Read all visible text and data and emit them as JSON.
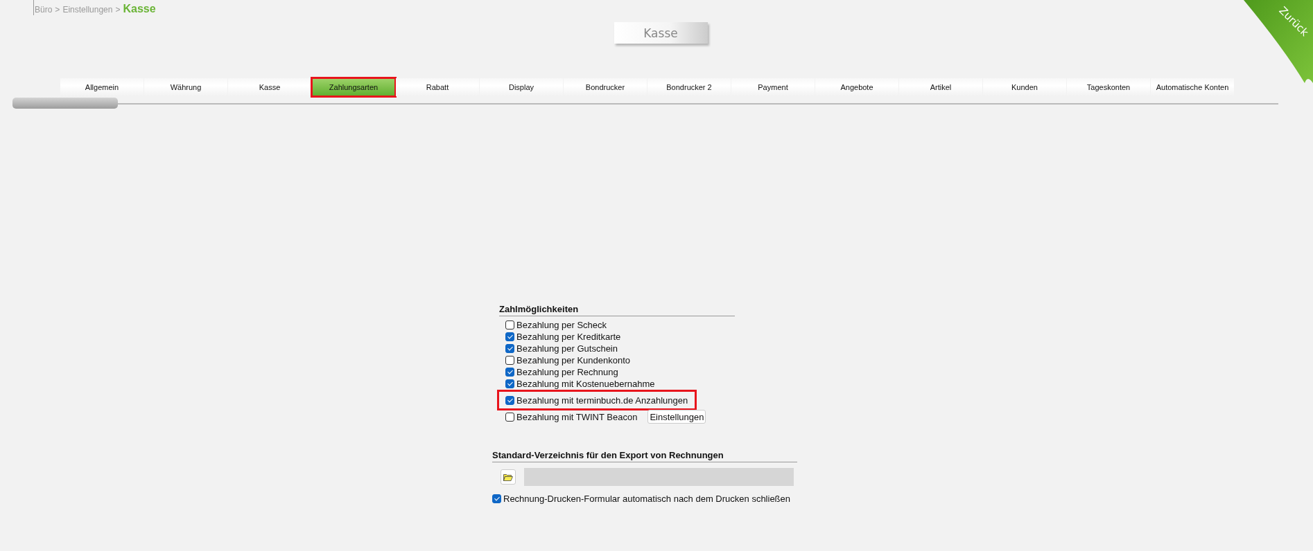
{
  "breadcrumb": {
    "items": [
      "Büro",
      "Einstellungen"
    ],
    "separator": ">",
    "current": "Kasse"
  },
  "page_title": "Kasse",
  "back_button": "Zurück",
  "tabs": [
    {
      "label": "Allgemein",
      "selected": false,
      "highlighted": false
    },
    {
      "label": "Währung",
      "selected": false,
      "highlighted": false
    },
    {
      "label": "Kasse",
      "selected": false,
      "highlighted": false
    },
    {
      "label": "Zahlungsarten",
      "selected": true,
      "highlighted": true
    },
    {
      "label": "Rabatt",
      "selected": false,
      "highlighted": false
    },
    {
      "label": "Display",
      "selected": false,
      "highlighted": false
    },
    {
      "label": "Bondrucker",
      "selected": false,
      "highlighted": false
    },
    {
      "label": "Bondrucker 2",
      "selected": false,
      "highlighted": false
    },
    {
      "label": "Payment",
      "selected": false,
      "highlighted": false
    },
    {
      "label": "Angebote",
      "selected": false,
      "highlighted": false
    },
    {
      "label": "Artikel",
      "selected": false,
      "highlighted": false
    },
    {
      "label": "Kunden",
      "selected": false,
      "highlighted": false
    },
    {
      "label": "Tageskonten",
      "selected": false,
      "highlighted": false
    },
    {
      "label": "Automatische Konten",
      "selected": false,
      "highlighted": false
    }
  ],
  "payment_options": {
    "title": "Zahlmöglichkeiten",
    "options": [
      {
        "label": "Bezahlung per Scheck",
        "checked": false,
        "highlighted": false
      },
      {
        "label": "Bezahlung per Kreditkarte",
        "checked": true,
        "highlighted": false
      },
      {
        "label": "Bezahlung per Gutschein",
        "checked": true,
        "highlighted": false
      },
      {
        "label": "Bezahlung per Kundenkonto",
        "checked": false,
        "highlighted": false
      },
      {
        "label": "Bezahlung per Rechnung",
        "checked": true,
        "highlighted": false
      },
      {
        "label": "Bezahlung mit Kostenuebernahme",
        "checked": true,
        "highlighted": false
      },
      {
        "label": "Bezahlung mit terminbuch.de Anzahlungen",
        "checked": true,
        "highlighted": true
      },
      {
        "label": "Bezahlung mit TWINT Beacon",
        "checked": false,
        "highlighted": false,
        "button": "Einstellungen"
      }
    ]
  },
  "export": {
    "title": "Standard-Verzeichnis für den Export von Rechnungen",
    "close_after_print": {
      "label": "Rechnung-Drucken-Formular automatisch nach dem Drucken schließen",
      "checked": true
    }
  }
}
